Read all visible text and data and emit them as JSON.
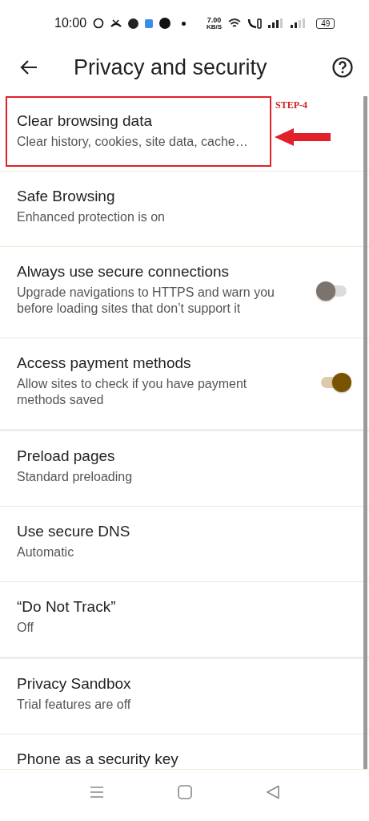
{
  "status_bar": {
    "time": "10:00",
    "speed": "7.00",
    "speed_unit": "KB/S",
    "battery": "49"
  },
  "header": {
    "title": "Privacy and security"
  },
  "annotation": {
    "label": "STEP-4"
  },
  "settings": [
    {
      "kind": "link",
      "title": "Clear browsing data",
      "subtitle": "Clear history, cookies, site data, cache…",
      "highlighted": true,
      "section_end": false
    },
    {
      "kind": "link",
      "title": "Safe Browsing",
      "subtitle": "Enhanced protection is on",
      "highlighted": false,
      "section_end": false
    },
    {
      "kind": "toggle",
      "title": "Always use secure connections",
      "subtitle": "Upgrade navigations to HTTPS and warn you before loading sites that don’t support it",
      "on": false,
      "highlighted": false,
      "section_end": false
    },
    {
      "kind": "toggle",
      "title": "Access payment methods",
      "subtitle": "Allow sites to check if you have payment methods saved",
      "on": true,
      "highlighted": false,
      "section_end": true
    },
    {
      "kind": "link",
      "title": "Preload pages",
      "subtitle": "Standard preloading",
      "highlighted": false,
      "section_end": false
    },
    {
      "kind": "link",
      "title": "Use secure DNS",
      "subtitle": "Automatic",
      "highlighted": false,
      "section_end": false
    },
    {
      "kind": "link",
      "title": "“Do Not Track”",
      "subtitle": "Off",
      "highlighted": false,
      "section_end": true
    },
    {
      "kind": "link",
      "title": "Privacy Sandbox",
      "subtitle": "Trial features are off",
      "highlighted": false,
      "section_end": false
    },
    {
      "kind": "link",
      "title": "Phone as a security key",
      "highlighted": false,
      "section_end": false
    }
  ]
}
